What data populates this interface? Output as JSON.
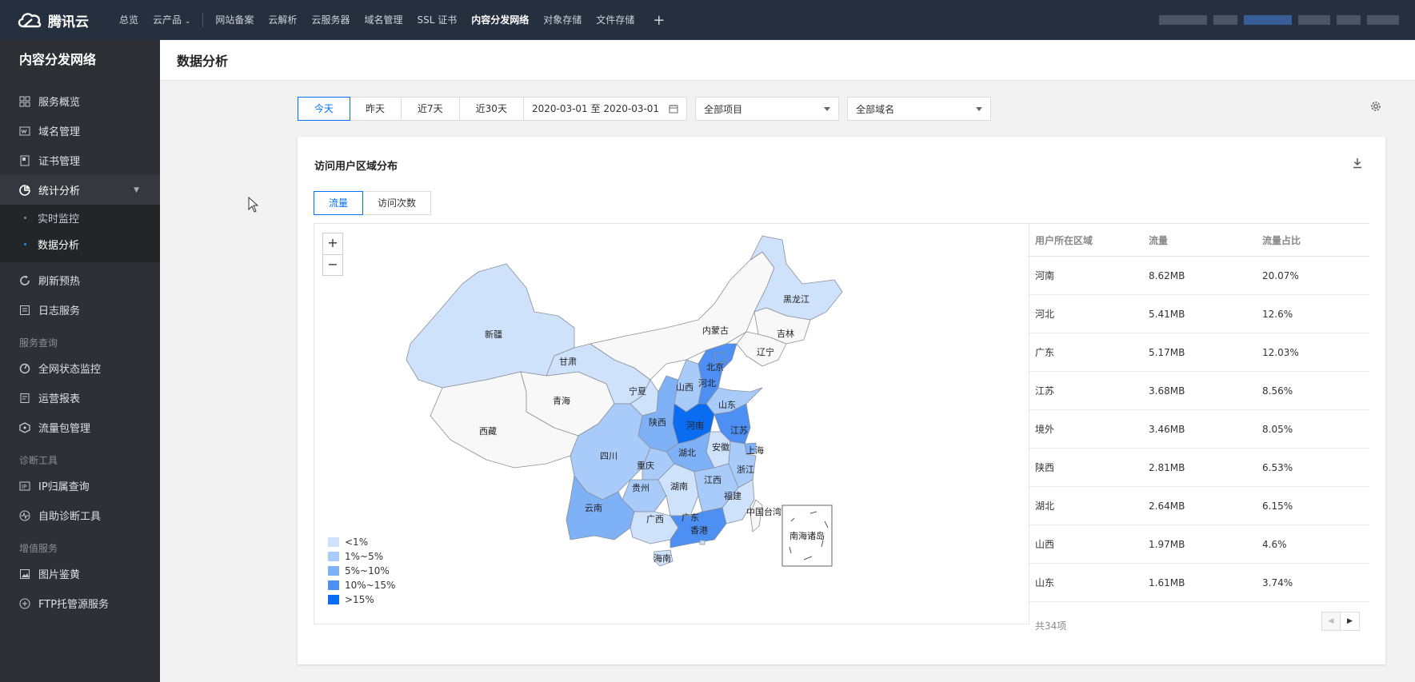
{
  "brand": {
    "name": "腾讯云"
  },
  "topnav": {
    "items": [
      "总览",
      "云产品",
      "网站备案",
      "云解析",
      "云服务器",
      "域名管理",
      "SSL 证书",
      "内容分发网络",
      "对象存储",
      "文件存储"
    ],
    "active": "内容分发网络",
    "plus": "+"
  },
  "sidebar": {
    "title": "内容分发网络",
    "items": [
      "服务概览",
      "域名管理",
      "证书管理",
      "统计分析"
    ],
    "sub": [
      "实时监控",
      "数据分析"
    ],
    "items2": [
      "刷新预热",
      "日志服务"
    ],
    "section1": "服务查询",
    "items3": [
      "全网状态监控",
      "运营报表",
      "流量包管理"
    ],
    "section2": "诊断工具",
    "items4": [
      "IP归属查询",
      "自助诊断工具"
    ],
    "section3": "增值服务",
    "items5": [
      "图片鉴黄",
      "FTP托管源服务"
    ]
  },
  "header": {
    "title": "数据分析"
  },
  "filters": {
    "ranges": [
      "今天",
      "昨天",
      "近7天",
      "近30天"
    ],
    "date_range": "2020-03-01 至 2020-03-01",
    "project": "全部项目",
    "domain": "全部域名"
  },
  "card": {
    "title": "访问用户区域分布",
    "tabs": [
      "流量",
      "访问次数"
    ],
    "zoom_in": "+",
    "zoom_out": "−",
    "legend": [
      {
        "label": "<1%",
        "color": "#cfe2fc"
      },
      {
        "label": "1%~5%",
        "color": "#a9cbfa"
      },
      {
        "label": "5%~10%",
        "color": "#7fb1f7"
      },
      {
        "label": "10%~15%",
        "color": "#4d8ff2"
      },
      {
        "label": ">15%",
        "color": "#0a6cf0"
      }
    ],
    "map_labels": [
      "新疆",
      "西藏",
      "青海",
      "甘肃",
      "内蒙古",
      "黑龙江",
      "吉林",
      "辽宁",
      "北京",
      "河北",
      "山西",
      "宁夏",
      "陕西",
      "河南",
      "山东",
      "江苏",
      "上海",
      "安徽",
      "湖北",
      "四川",
      "重庆",
      "浙江",
      "贵州",
      "湖南",
      "江西",
      "福建",
      "云南",
      "广西",
      "广东",
      "香港",
      "中国台湾",
      "海南",
      "南海诸岛"
    ],
    "table": {
      "headers": [
        "用户所在区域",
        "流量",
        "流量占比"
      ],
      "rows": [
        [
          "河南",
          "8.62MB",
          "20.07%"
        ],
        [
          "河北",
          "5.41MB",
          "12.6%"
        ],
        [
          "广东",
          "5.17MB",
          "12.03%"
        ],
        [
          "江苏",
          "3.68MB",
          "8.56%"
        ],
        [
          "境外",
          "3.46MB",
          "8.05%"
        ],
        [
          "陕西",
          "2.81MB",
          "6.53%"
        ],
        [
          "湖北",
          "2.64MB",
          "6.15%"
        ],
        [
          "山西",
          "1.97MB",
          "4.6%"
        ],
        [
          "山东",
          "1.61MB",
          "3.74%"
        ]
      ],
      "total": "共34项"
    }
  }
}
